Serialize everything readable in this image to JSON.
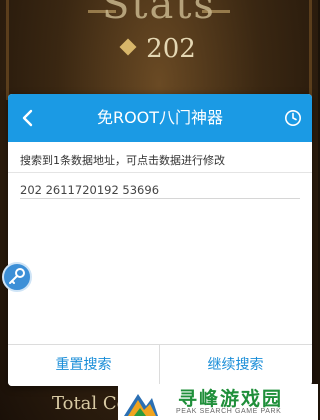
{
  "game_bg": {
    "header_text": "Stats",
    "score": "202",
    "total_label": "Total Co"
  },
  "dialog": {
    "title": "免ROOT八门神器",
    "info": "搜索到1条数据地址，可点击数据进行修改",
    "result": "202 2611720192 53696",
    "reset_button": "重置搜索",
    "continue_button": "继续搜索"
  },
  "watermark": {
    "title": "寻峰游戏园",
    "subtitle": "PEAK SEARCH GAME PARK"
  },
  "colors": {
    "header_blue": "#1b9ae4",
    "button_text": "#1b8ed8"
  },
  "icons": [
    "back-arrow-icon",
    "history-clock-icon",
    "key-icon"
  ]
}
